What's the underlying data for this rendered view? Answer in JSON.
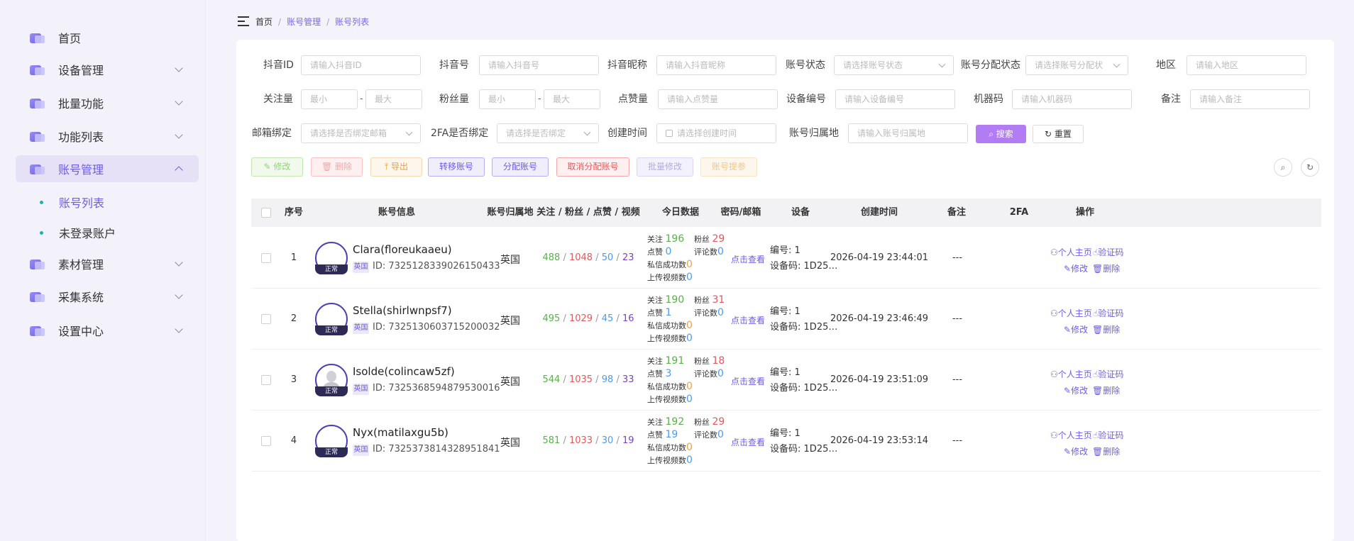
{
  "sidebar": {
    "items": [
      {
        "label": "首页",
        "has_children": false
      },
      {
        "label": "设备管理",
        "has_children": true
      },
      {
        "label": "批量功能",
        "has_children": true
      },
      {
        "label": "功能列表",
        "has_children": true
      },
      {
        "label": "账号管理",
        "has_children": true,
        "active": true
      },
      {
        "label": "素材管理",
        "has_children": true
      },
      {
        "label": "采集系统",
        "has_children": true
      },
      {
        "label": "设置中心",
        "has_children": true
      }
    ],
    "sub_items": [
      {
        "label": "账号列表",
        "active": true
      },
      {
        "label": "未登录账户"
      }
    ]
  },
  "breadcrumb": {
    "home": "首页",
    "level1": "账号管理",
    "level2": "账号列表",
    "separator": "/"
  },
  "filters": {
    "douyin_id": {
      "label": "抖音ID",
      "placeholder": "请输入抖音ID"
    },
    "douyin_no": {
      "label": "抖音号",
      "placeholder": "请输入抖音号"
    },
    "nickname": {
      "label": "抖音昵称",
      "placeholder": "请输入抖音昵称"
    },
    "account_status": {
      "label": "账号状态",
      "placeholder": "请选择账号状态"
    },
    "assign_status": {
      "label": "账号分配状态",
      "placeholder": "请选择账号分配状"
    },
    "region": {
      "label": "地区",
      "placeholder": "请输入地区"
    },
    "follow": {
      "label": "关注量",
      "min": "最小",
      "max": "最大",
      "dash": "-"
    },
    "fans": {
      "label": "粉丝量",
      "min": "最小",
      "max": "最大",
      "dash": "-"
    },
    "likes": {
      "label": "点赞量",
      "placeholder": "请输入点赞量"
    },
    "device_no": {
      "label": "设备编号",
      "placeholder": "请输入设备编号"
    },
    "machine_code": {
      "label": "机器码",
      "placeholder": "请输入机器码"
    },
    "remark": {
      "label": "备注",
      "placeholder": "请输入备注"
    },
    "email_bind": {
      "label": "邮箱绑定",
      "placeholder": "请选择是否绑定邮箱"
    },
    "twofa_bind": {
      "label": "2FA是否绑定",
      "placeholder": "请选择是否绑定"
    },
    "create_time": {
      "label": "创建时间",
      "placeholder": "请选择创建时间"
    },
    "account_region": {
      "label": "账号归属地",
      "placeholder": "请输入账号归属地"
    },
    "search_label": "搜索",
    "reset_label": "重置"
  },
  "toolbar": {
    "edit": "修改",
    "delete": "删除",
    "export": "导出",
    "transfer": "转移账号",
    "assign": "分配账号",
    "unassign": "取消分配账号",
    "batch_edit": "批量修改",
    "extract": "账号提参"
  },
  "table": {
    "headers": [
      "序号",
      "账号信息",
      "账号归属地",
      "关注 / 粉丝 / 点赞 / 视频",
      "今日数据",
      "密码/邮箱",
      "设备",
      "创建时间",
      "备注",
      "2FA",
      "操作"
    ],
    "today_labels": {
      "follow": "关注",
      "fans": "粉丝",
      "likes": "点赞",
      "comments": "评论数",
      "dm": "私信成功数",
      "upload": "上传视频数"
    },
    "device_labels": {
      "no": "编号:",
      "code": "设备码:"
    },
    "op_labels": {
      "home": "个人主页",
      "code": "验证码",
      "edit": "修改",
      "delete": "删除"
    },
    "pwd_link": "点击查看",
    "stat_sep": "/",
    "rows": [
      {
        "idx": "1",
        "status": "正常",
        "name": "Clara(floreukaaeu)",
        "region_tag": "英国",
        "id": "ID: 7325128339026150433",
        "region": "英国",
        "follow": "488",
        "fans": "1048",
        "likes": "50",
        "videos": "23",
        "t_follow": "196",
        "t_fans": "29",
        "t_likes": "0",
        "t_comments": "0",
        "t_dm": "0",
        "t_upload": "0",
        "device_no": "1",
        "device_code": "1D25…",
        "ctime": "2026-04-19 23:44:01",
        "remark": "---",
        "avatar_photo": false
      },
      {
        "idx": "2",
        "status": "正常",
        "name": "Stella(shirlwnpsf7)",
        "region_tag": "英国",
        "id": "ID: 7325130603715200032",
        "region": "英国",
        "follow": "495",
        "fans": "1029",
        "likes": "45",
        "videos": "16",
        "t_follow": "190",
        "t_fans": "31",
        "t_likes": "1",
        "t_comments": "0",
        "t_dm": "0",
        "t_upload": "0",
        "device_no": "1",
        "device_code": "1D25…",
        "ctime": "2026-04-19 23:46:49",
        "remark": "---",
        "avatar_photo": false
      },
      {
        "idx": "3",
        "status": "正常",
        "name": "Isolde(colincaw5zf)",
        "region_tag": "英国",
        "id": "ID: 7325368594879530016",
        "region": "英国",
        "follow": "544",
        "fans": "1035",
        "likes": "98",
        "videos": "33",
        "t_follow": "191",
        "t_fans": "18",
        "t_likes": "3",
        "t_comments": "0",
        "t_dm": "0",
        "t_upload": "0",
        "device_no": "1",
        "device_code": "1D25…",
        "ctime": "2026-04-19 23:51:09",
        "remark": "---",
        "avatar_photo": true
      },
      {
        "idx": "4",
        "status": "正常",
        "name": "Nyx(matilaxgu5b)",
        "region_tag": "英国",
        "id": "ID: 7325373814328951841",
        "region": "英国",
        "follow": "581",
        "fans": "1033",
        "likes": "30",
        "videos": "19",
        "t_follow": "192",
        "t_fans": "29",
        "t_likes": "19",
        "t_comments": "0",
        "t_dm": "0",
        "t_upload": "0",
        "device_no": "1",
        "device_code": "1D25…",
        "ctime": "2026-04-19 23:53:14",
        "remark": "---",
        "avatar_photo": false
      }
    ]
  },
  "colors": {
    "accent": "#6c5ce7",
    "search": "#b27cf2",
    "green": "#57b247",
    "red": "#e05a5a",
    "blue": "#4a9df0",
    "purple": "#7b3fd1",
    "orange": "#f0a040"
  }
}
